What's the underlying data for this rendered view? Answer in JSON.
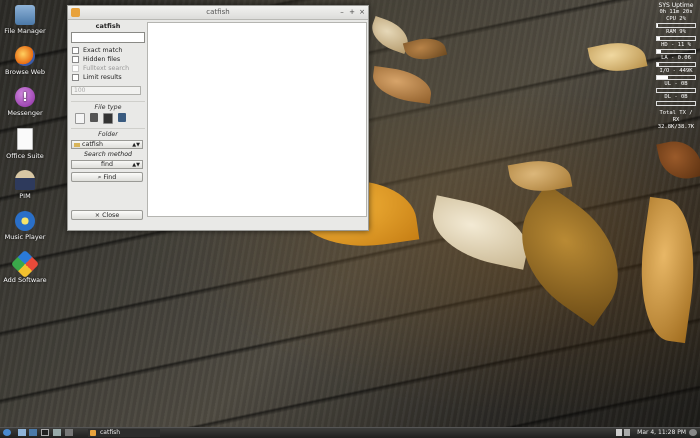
{
  "desktop": {
    "icons": [
      {
        "label": "File Manager",
        "icon": "folder-icon"
      },
      {
        "label": "Browse Web",
        "icon": "firefox-icon"
      },
      {
        "label": "Messenger",
        "icon": "messenger-icon"
      },
      {
        "label": "Office Suite",
        "icon": "document-icon"
      },
      {
        "label": "PIM",
        "icon": "pim-icon"
      },
      {
        "label": "Music Player",
        "icon": "music-icon"
      },
      {
        "label": "Add Software",
        "icon": "software-icon"
      }
    ]
  },
  "conky": {
    "title": "SYS Uptime",
    "uptime": "0h 11m 20s",
    "cpu": {
      "label": "CPU 2%",
      "level": 0.02
    },
    "ram": {
      "label": "RAM 9%",
      "level": 0.09
    },
    "hd": {
      "label": "HD - 11 %",
      "level": 0.11
    },
    "la": {
      "label": "LA - 0.06",
      "level": 0.06
    },
    "io": {
      "label": "I/O - 449K",
      "level": 0.3
    },
    "ul": {
      "label": "UL - 0B",
      "level": 0
    },
    "dl": {
      "label": "DL - 0B",
      "level": 0
    },
    "total_label": "Total TX / RX",
    "total_value": "32.8K/38.7K"
  },
  "window": {
    "title": "catfish",
    "minimize_glyph": "–",
    "maximize_glyph": "+",
    "close_glyph": "×",
    "search_header": "catfish",
    "search_value": "",
    "options": [
      {
        "label": "Exact match",
        "checked": false,
        "enabled": true
      },
      {
        "label": "Hidden files",
        "checked": false,
        "enabled": true
      },
      {
        "label": "Fulltext search",
        "checked": false,
        "enabled": false
      },
      {
        "label": "Limit results",
        "checked": false,
        "enabled": true
      }
    ],
    "limit_value": "100",
    "file_type_label": "File type",
    "folder_label": "Folder",
    "folder_value": "catfish",
    "search_method_label": "Search method",
    "search_method_value": "find",
    "find_button": "Find",
    "close_button": "Close"
  },
  "taskbar": {
    "task_label": "catfish",
    "clock": "Mar 4, 11:28 PM"
  }
}
